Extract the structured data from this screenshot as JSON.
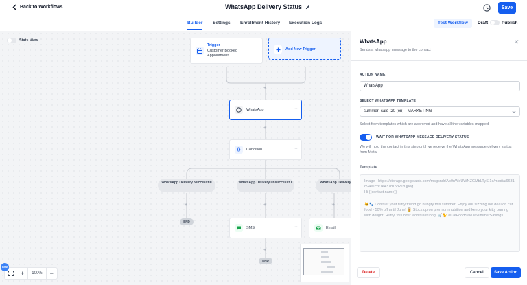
{
  "header": {
    "back_label": "Back to Workflows",
    "title": "WhatsApp Delivery Status",
    "save_label": "Save"
  },
  "tabs": [
    {
      "label": "Builder",
      "active": true
    },
    {
      "label": "Settings"
    },
    {
      "label": "Enrollment History"
    },
    {
      "label": "Execution Logs"
    }
  ],
  "tab_actions": {
    "test_workflow": "Test Workflow",
    "draft": "Draft",
    "publish": "Publish"
  },
  "canvas": {
    "stats_view": "Stats View",
    "trigger": {
      "title": "Trigger",
      "subtitle": "Customer Booked Appointment"
    },
    "add_trigger": "Add New Trigger",
    "whatsapp_node": "WhatsApp",
    "condition_node": "Condition",
    "branches": [
      "WhatsApp Delivery Successful",
      "WhatsApp Delivery unsuccessful",
      "WhatsApp Delivery Failed"
    ],
    "end_label": "END",
    "sms_node": "SMS",
    "email_node": "Email",
    "zoom": "100%"
  },
  "panel": {
    "title": "WhatsApp",
    "subtitle": "Sends a whatsapp message to the contact",
    "action_name_label": "ACTION NAME",
    "action_name_value": "WhatsApp",
    "template_label": "SELECT WHATSAPP TEMPLATE",
    "template_value": "summer_sale_20 (en) - MARKETING",
    "template_help": "Select from templates which are approved and have all the variables mapped",
    "wait_label": "WAIT FOR WHATSAPP MESSAGE DELIVERY STATUS",
    "wait_help": "We will hold the contact in this step until we receive the WhatsApp message delivery status from Meta",
    "template_section": "Template",
    "template_body_line1": "Image - https://storage.googleapis.com/msgsndr/Ab9nWqUWNZGMbLTySI1e/media/6631d94e1cbf1e437d153218.jpeg",
    "template_body_line2": "Hi {{contact.name}}",
    "template_body_line3": "🐱🐾 Don't let your furry friend go hungry this summer! Enjoy our sizzling hot deal on cat food - 50% off until June! 🥫 Stock up on premium nutrition and keep your kitty purring with delight. Hurry, this offer won't last long! 🛒🐈 #CatFoodSale #SummerSavings",
    "delete_label": "Delete",
    "cancel_label": "Cancel",
    "save_action_label": "Save Action"
  },
  "user": {
    "avatar_initials": "BSM"
  },
  "colors": {
    "primary": "#155eef",
    "danger": "#dc2626"
  }
}
